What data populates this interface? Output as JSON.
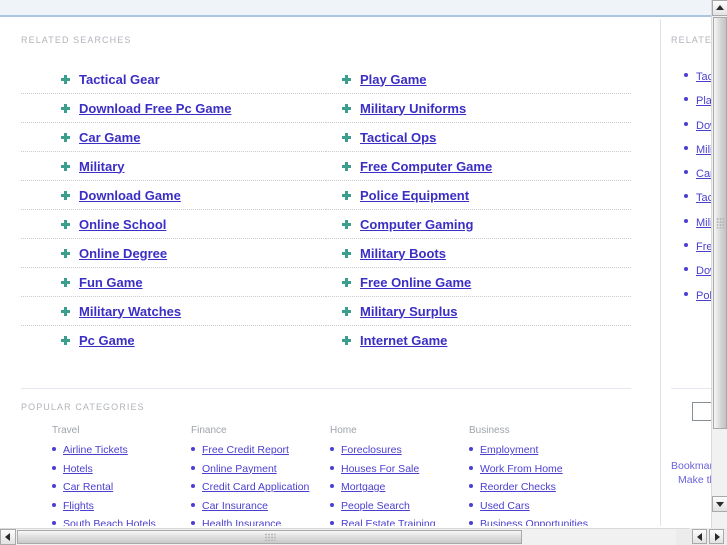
{
  "page": {
    "related_searches_label": "RELATED SEARCHES",
    "popular_categories_label": "POPULAR CATEGORIES",
    "sidebar_related_label": "RELATED",
    "accent_link_color": "#3b2ec4",
    "bullet_color": "#4b3fd0",
    "marker_color": "#3c9e8d",
    "header_bg": "#eff4f9",
    "header_border": "#a8c6e0"
  },
  "related_searches": {
    "left": [
      {
        "label": "Tactical Gear",
        "underlined": false
      },
      {
        "label": "Download Free Pc Game",
        "underlined": true
      },
      {
        "label": "Car Game",
        "underlined": true
      },
      {
        "label": "Military",
        "underlined": true
      },
      {
        "label": "Download Game",
        "underlined": true
      },
      {
        "label": "Online School",
        "underlined": true
      },
      {
        "label": "Online Degree",
        "underlined": true
      },
      {
        "label": "Fun Game",
        "underlined": true
      },
      {
        "label": "Military Watches",
        "underlined": true
      },
      {
        "label": "Pc Game",
        "underlined": true
      }
    ],
    "right": [
      {
        "label": "Play Game",
        "underlined": true
      },
      {
        "label": "Military Uniforms",
        "underlined": true
      },
      {
        "label": "Tactical Ops",
        "underlined": true
      },
      {
        "label": "Free Computer Game",
        "underlined": true
      },
      {
        "label": "Police Equipment",
        "underlined": true
      },
      {
        "label": "Computer Gaming",
        "underlined": true
      },
      {
        "label": "Military Boots",
        "underlined": true
      },
      {
        "label": "Free Online Game",
        "underlined": true
      },
      {
        "label": "Military Surplus",
        "underlined": true
      },
      {
        "label": "Internet Game",
        "underlined": true
      }
    ]
  },
  "popular_categories": [
    {
      "title": "Travel",
      "items": [
        "Airline Tickets",
        "Hotels",
        "Car Rental",
        "Flights",
        "South Beach Hotels"
      ]
    },
    {
      "title": "Finance",
      "items": [
        "Free Credit Report",
        "Online Payment",
        "Credit Card Application",
        "Car Insurance",
        "Health Insurance"
      ]
    },
    {
      "title": "Home",
      "items": [
        "Foreclosures",
        "Houses For Sale",
        "Mortgage",
        "People Search",
        "Real Estate Training"
      ]
    },
    {
      "title": "Business",
      "items": [
        "Employment",
        "Work From Home",
        "Reorder Checks",
        "Used Cars",
        "Business Opportunities"
      ]
    }
  ],
  "sidebar": {
    "items": [
      "Tactical Gear",
      "Play Game",
      "Download Free Pc Game",
      "Military Uniforms",
      "Car Game",
      "Tactical Ops",
      "Military",
      "Free Computer Game",
      "Download Game",
      "Police Equipment"
    ],
    "search_value": "",
    "search_placeholder": "",
    "footer_links": [
      "Bookmark",
      "Make this"
    ]
  },
  "scrollbars": {
    "vertical_position_percent": 3,
    "horizontal_position_percent": 0
  }
}
